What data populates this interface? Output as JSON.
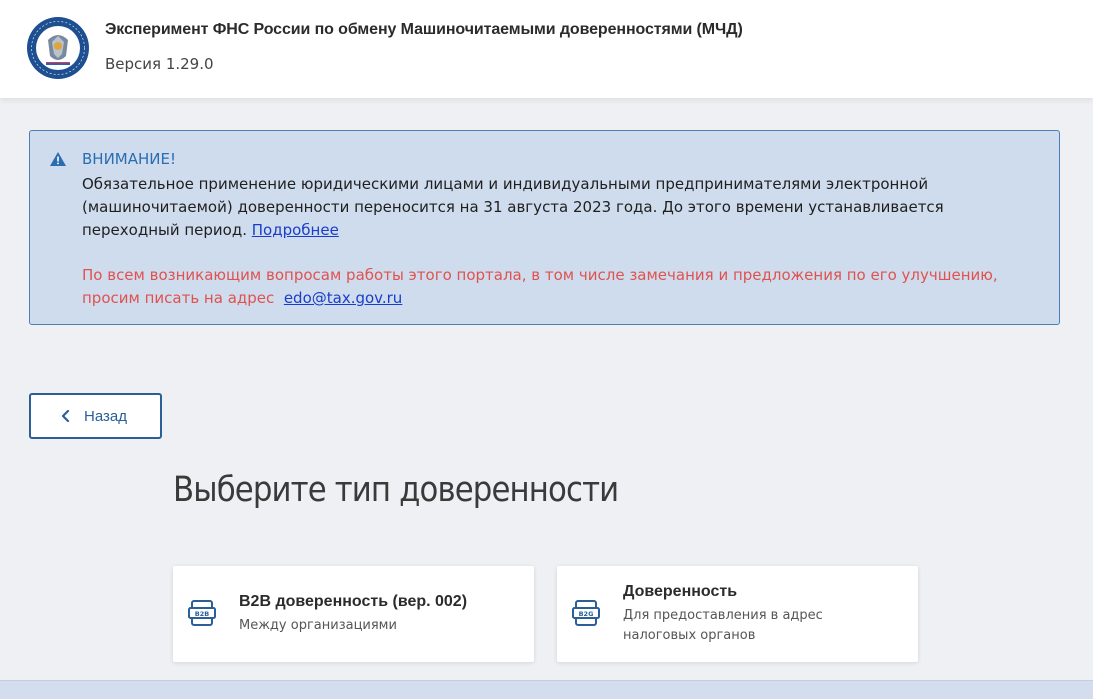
{
  "header": {
    "title": "Эксперимент ФНС России по обмену Машиночитаемыми доверенностями (МЧД)",
    "version": "Версия 1.29.0",
    "logo_icon": "fns-emblem-icon"
  },
  "alert": {
    "icon": "warning-triangle-icon",
    "title": "ВНИМАНИЕ!",
    "body_text": "Обязательное применение юридическими лицами и индивидуальными предпринимателями электронной (машиночитаемой) доверенности переносится на 31 августа 2023 года. До этого времени устанавливается переходный период.",
    "more_link": "Подробнее",
    "contact_text": "По всем возникающим вопросам работы этого портала, в том числе замечания и предложения по его улучшению, просим писать на адрес",
    "contact_email": "edo@tax.gov.ru",
    "colors": {
      "background": "#cfdced",
      "title": "#2a6db0",
      "contact": "#e0524f"
    }
  },
  "back_button": {
    "label": "Назад",
    "icon": "chevron-left-icon"
  },
  "main": {
    "heading": "Выберите тип доверенности",
    "cards": [
      {
        "icon": "b2b-icon",
        "icon_text": "B2B",
        "title": "B2B доверенность (вер. 002)",
        "subtitle": "Между организациями"
      },
      {
        "icon": "b2g-icon",
        "icon_text": "B2G",
        "title": "Доверенность",
        "subtitle": "Для предоставления в адрес налоговых органов"
      }
    ]
  },
  "colors": {
    "accent": "#2a5f98",
    "page_background": "#eef0f3"
  }
}
